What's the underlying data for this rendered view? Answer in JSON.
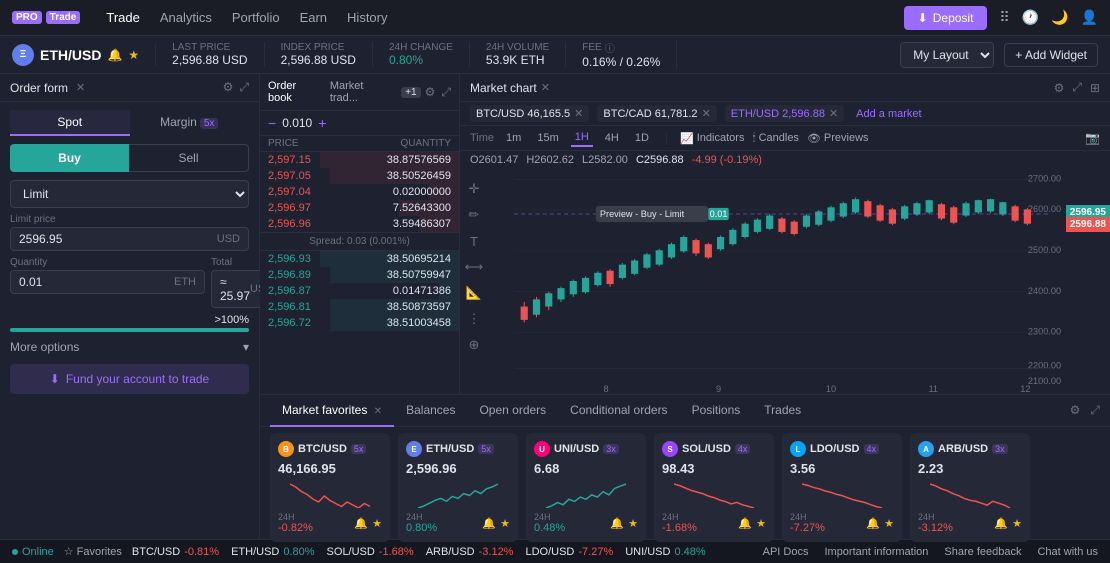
{
  "nav": {
    "logo": "PRO",
    "brand": "Trade",
    "items": [
      "Trade",
      "Analytics",
      "Portfolio",
      "Earn",
      "History"
    ],
    "active": "Trade",
    "deposit_label": "Deposit",
    "my_layout": "My Layout",
    "add_widget": "+ Add Widget"
  },
  "asset": {
    "symbol": "ETH",
    "pair": "ETH/USD",
    "last_price_label": "LAST PRICE",
    "last_price": "2,596.88",
    "last_price_unit": "USD",
    "index_price_label": "INDEX PRICE",
    "index_price": "2,596.88",
    "index_price_unit": "USD",
    "change_label": "24H CHANGE",
    "change": "0.80%",
    "volume_label": "24H VOLUME",
    "volume": "53.9K",
    "volume_unit": "ETH",
    "fee_label": "FEE",
    "fee1": "0.16%",
    "fee2": "0.26%"
  },
  "order_form": {
    "title": "Order form",
    "spot_label": "Spot",
    "margin_label": "Margin",
    "margin_count": "5x",
    "buy_label": "Buy",
    "sell_label": "Sell",
    "order_type": "Limit",
    "limit_price_label": "Limit price",
    "limit_price_value": "2596.95",
    "limit_price_unit": "USD",
    "quantity_label": "Quantity",
    "quantity_value": "0.01",
    "quantity_unit": "ETH",
    "total_label": "Total",
    "total_value": "≈ 25.97",
    "total_unit": "USD",
    "progress_label": ">100%",
    "more_options_label": "More options",
    "fund_label": "Fund your account to trade"
  },
  "order_book": {
    "title": "Order book",
    "tab1": "Order book",
    "tab2": "Market trad...",
    "plus_count": "+1",
    "spread_value": "0.010",
    "spread_text": "Spread: 0.03 (0.001%)",
    "col_price": "PRICE",
    "col_qty": "QUANTITY",
    "sells": [
      {
        "price": "2,597.15",
        "qty": "38.87576569",
        "pct": 70
      },
      {
        "price": "2,597.05",
        "qty": "38.50526459",
        "pct": 65
      },
      {
        "price": "2,597.04",
        "qty": "0.02000000",
        "pct": 15
      },
      {
        "price": "2,596.97",
        "qty": "7.52643300",
        "pct": 30
      },
      {
        "price": "2,596.96",
        "qty": "3.59486307",
        "pct": 20
      }
    ],
    "buys": [
      {
        "price": "2,596.93",
        "qty": "38.50695214",
        "pct": 70
      },
      {
        "price": "2,596.89",
        "qty": "38.50759947",
        "pct": 65
      },
      {
        "price": "2,596.87",
        "qty": "0.01471386",
        "pct": 10
      },
      {
        "price": "2,596.81",
        "qty": "38.50873597",
        "pct": 65
      },
      {
        "price": "2,596.72",
        "qty": "38.51003458",
        "pct": 65
      }
    ]
  },
  "chart": {
    "panel_title": "Market chart",
    "market_tabs": [
      "BTC/USD",
      "BTC/CAD",
      "ETH/USD"
    ],
    "market_prices": [
      "46,165.5",
      "61,781.2",
      "2,596.88"
    ],
    "add_market": "Add a market",
    "time_label": "Time",
    "time_options": [
      "1m",
      "15m",
      "1H",
      "4H",
      "1D"
    ],
    "active_time": "1H",
    "indicators_label": "Indicators",
    "candles_label": "Candles",
    "previews_label": "Previews",
    "ohlc_o": "O2601.47",
    "ohlc_h": "H2602.62",
    "ohlc_l": "L2582.00",
    "ohlc_c": "C2596.88",
    "ohlc_chg": "-4.99 (-0.19%)",
    "preview_label": "Preview - Buy - Limit",
    "preview_value": "0.01",
    "price_high": "2596.95",
    "price_low": "2596.88",
    "y_labels": [
      "2700.00",
      "2600.00",
      "2500.00",
      "2400.00",
      "2300.00",
      "2200.00",
      "2100.00"
    ],
    "x_labels": [
      "8",
      "9",
      "10",
      "11",
      "12"
    ]
  },
  "bottom": {
    "tabs": [
      "Market favorites",
      "Balances",
      "Open orders",
      "Conditional orders",
      "Positions",
      "Trades"
    ],
    "active_tab": "Market favorites",
    "favorites": [
      {
        "symbol": "BTC",
        "pair": "BTC/USD",
        "count": "5x",
        "price": "46,166.95",
        "change": "-0.82%",
        "change_dir": "neg",
        "icon_class": "btc"
      },
      {
        "symbol": "ETH",
        "pair": "ETH/USD",
        "count": "5x",
        "price": "2,596.96",
        "change": "0.80%",
        "change_dir": "pos",
        "icon_class": "eth"
      },
      {
        "symbol": "UNI",
        "pair": "UNI/USD",
        "count": "3x",
        "price": "6.68",
        "change": "0.48%",
        "change_dir": "pos",
        "icon_class": "uni"
      },
      {
        "symbol": "SOL",
        "pair": "SOL/USD",
        "count": "4x",
        "price": "98.43",
        "change": "-1.68%",
        "change_dir": "neg",
        "icon_class": "sol"
      },
      {
        "symbol": "LDO",
        "pair": "LDO/USD",
        "count": "4x",
        "price": "3.56",
        "change": "-7.27%",
        "change_dir": "neg",
        "icon_class": "ldo"
      },
      {
        "symbol": "ARB",
        "pair": "ARB/USD",
        "count": "3x",
        "price": "2.23",
        "change": "-3.12%",
        "change_dir": "neg",
        "icon_class": "arb"
      }
    ]
  },
  "status": {
    "online_label": "Online",
    "favorites_label": "Favorites",
    "tickers": [
      {
        "pair": "BTC/USD",
        "change": "-0.81%",
        "dir": "neg"
      },
      {
        "pair": "ETH/USD",
        "change": "0.80%",
        "dir": "pos"
      },
      {
        "pair": "SOL/USD",
        "change": "-1.68%",
        "dir": "neg"
      },
      {
        "pair": "ARB/USD",
        "change": "-3.12%",
        "dir": "neg"
      },
      {
        "pair": "LDO/USD",
        "change": "-7.27%",
        "dir": "neg"
      },
      {
        "pair": "UNI/USD",
        "change": "0.48%",
        "dir": "pos"
      }
    ],
    "links": [
      "API Docs",
      "Important information",
      "Share feedback",
      "Chat with us"
    ]
  }
}
